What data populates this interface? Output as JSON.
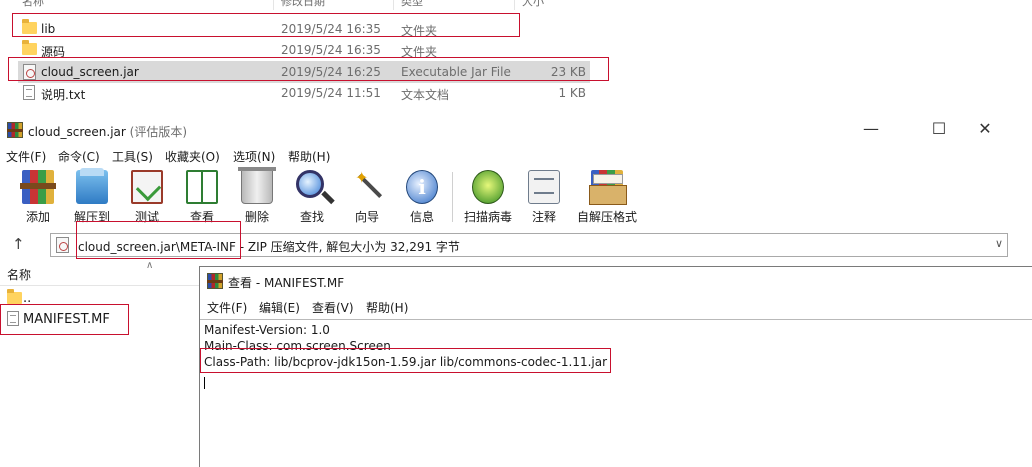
{
  "explorer": {
    "columns": [
      "名称",
      "修改日期",
      "类型",
      "大小"
    ],
    "files": [
      {
        "name": "lib",
        "date": "2019/5/24 16:35",
        "type": "文件夹",
        "size": "",
        "icon": "folder-icon"
      },
      {
        "name": "源码",
        "date": "2019/5/24 16:35",
        "type": "文件夹",
        "size": "",
        "icon": "folder-icon"
      },
      {
        "name": "cloud_screen.jar",
        "date": "2019/5/24 16:25",
        "type": "Executable Jar File",
        "size": "23 KB",
        "icon": "jar-file-icon"
      },
      {
        "name": "说明.txt",
        "date": "2019/5/24 11:51",
        "type": "文本文档",
        "size": "1 KB",
        "icon": "text-file-icon"
      }
    ]
  },
  "winrar": {
    "title": "cloud_screen.jar",
    "title_suffix": "(评估版本)",
    "menu": [
      "文件(F)",
      "命令(C)",
      "工具(S)",
      "收藏夹(O)",
      "选项(N)",
      "帮助(H)"
    ],
    "toolbar": [
      {
        "label": "添加",
        "icon": "add-archive-icon"
      },
      {
        "label": "解压到",
        "icon": "extract-to-icon"
      },
      {
        "label": "测试",
        "icon": "test-icon"
      },
      {
        "label": "查看",
        "icon": "view-icon"
      },
      {
        "label": "删除",
        "icon": "delete-icon"
      },
      {
        "label": "查找",
        "icon": "find-icon"
      },
      {
        "label": "向导",
        "icon": "wizard-icon"
      },
      {
        "label": "信息",
        "icon": "info-icon"
      },
      {
        "label": "扫描病毒",
        "icon": "virus-scan-icon"
      },
      {
        "label": "注释",
        "icon": "comment-icon"
      },
      {
        "label": "自解压格式",
        "icon": "sfx-icon"
      }
    ],
    "address_path": "cloud_screen.jar\\META-INF",
    "address_info": " - ZIP 压缩文件, 解包大小为 32,291 字节",
    "list_header": "名称",
    "list_items": [
      {
        "name": "..",
        "icon": "folder-icon"
      },
      {
        "name": "MANIFEST.MF",
        "icon": "file-icon"
      }
    ]
  },
  "viewer": {
    "title": "查看 - MANIFEST.MF",
    "menu": [
      "文件(F)",
      "编辑(E)",
      "查看(V)",
      "帮助(H)"
    ],
    "lines": [
      "Manifest-Version: 1.0",
      "Main-Class: com.screen.Screen",
      "Class-Path: lib/bcprov-jdk15on-1.59.jar lib/commons-codec-1.11.jar"
    ]
  },
  "info_glyph": "i",
  "colors": {
    "highlight_box": "#c8102e",
    "selected_row": "#d9d9d9"
  }
}
